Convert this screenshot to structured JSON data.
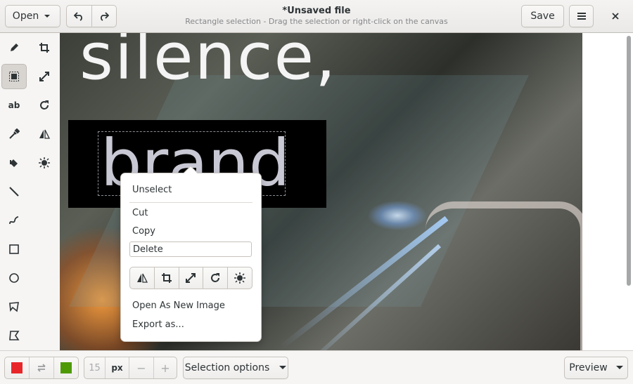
{
  "header": {
    "open_label": "Open",
    "title": "*Unsaved file",
    "subtitle": "Rectangle selection - Drag the selection or right-click on the canvas",
    "save_label": "Save"
  },
  "toolbar": {
    "tools": [
      {
        "name": "pencil-icon"
      },
      {
        "name": "crop-icon"
      },
      {
        "name": "rectangle-selection-icon",
        "active": true
      },
      {
        "name": "scale-icon"
      },
      {
        "name": "text-icon",
        "glyph": "ab"
      },
      {
        "name": "rotate-icon"
      },
      {
        "name": "color-picker-icon"
      },
      {
        "name": "flip-icon"
      },
      {
        "name": "paint-bucket-icon"
      },
      {
        "name": "filters-icon"
      },
      {
        "name": "line-icon"
      },
      {
        "name": "curve-icon"
      },
      {
        "name": "rectangle-icon"
      },
      {
        "name": "circle-icon"
      },
      {
        "name": "free-shape-icon"
      },
      {
        "name": "skew-icon"
      }
    ]
  },
  "canvas": {
    "text_top": "silence,",
    "text_selected": "brand"
  },
  "context_menu": {
    "unselect": "Unselect",
    "cut": "Cut",
    "copy": "Copy",
    "delete": "Delete",
    "open_as_new": "Open As New Image",
    "export_as": "Export as...",
    "icon_buttons": [
      "flip-icon",
      "crop-icon",
      "scale-icon",
      "rotate-icon",
      "filters-icon"
    ]
  },
  "bottom": {
    "left_color": "#e8262a",
    "right_color": "#4e9a06",
    "size_value": "15",
    "size_unit": "px",
    "minus": "−",
    "plus": "+",
    "selection_options": "Selection options",
    "preview": "Preview"
  }
}
